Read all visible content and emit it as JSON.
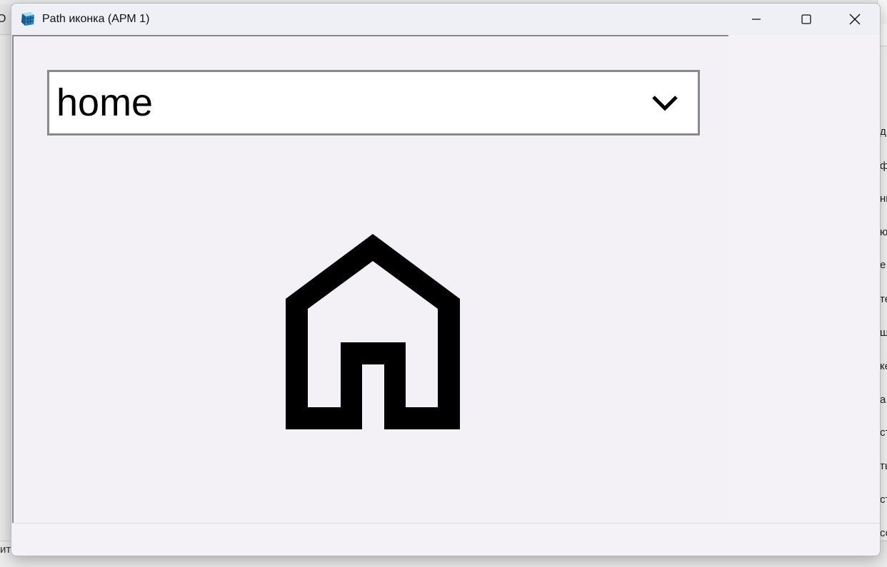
{
  "window": {
    "title": "Path иконка (АРМ 1)",
    "controls": {
      "minimize": "minimize",
      "maximize": "maximize",
      "close": "close"
    }
  },
  "icon_selector": {
    "selected": "home",
    "preview_icon": "home-icon"
  },
  "background": {
    "left_fragment": "О",
    "bottom_fragment": "итр",
    "right_fragments": [
      "д",
      "ф",
      "нн",
      "ю",
      "е",
      "те",
      "ш",
      "ке",
      "а",
      "ст",
      "ть",
      "ст",
      "со"
    ]
  },
  "colors": {
    "window_bg": "#f4f1f7",
    "border": "#8a8a8a",
    "icon": "#000000"
  }
}
